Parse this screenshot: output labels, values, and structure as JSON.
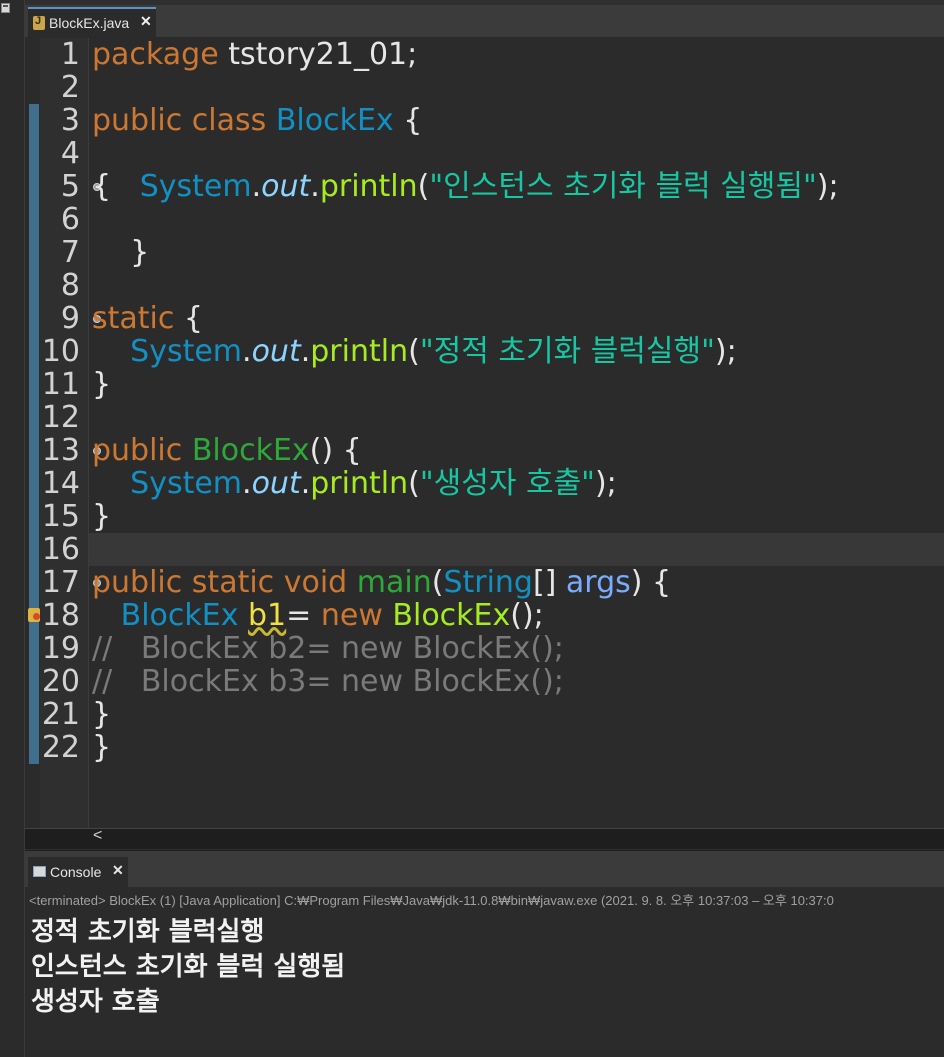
{
  "editor_tab": {
    "label": "BlockEx.java",
    "close": "✕"
  },
  "line_numbers": [
    "1",
    "2",
    "3",
    "4",
    "5",
    "6",
    "7",
    "8",
    "9",
    "10",
    "11",
    "12",
    "13",
    "14",
    "15",
    "16",
    "17",
    "18",
    "19",
    "20",
    "21",
    "22"
  ],
  "code": {
    "l1_kw": "package",
    "l1_rest": " tstory21_01;",
    "l3_kw": "public class",
    "l3_cls": "BlockEx",
    "l3_rest": " {",
    "l5_brace": "{   ",
    "l5_sys": "System",
    "l5_dot1": ".",
    "l5_out": "out",
    "l5_dot2": ".",
    "l5_meth": "println",
    "l5_p1": "(",
    "l5_str": "\"인스턴스 초기화 블럭 실행됨\"",
    "l5_p2": ");",
    "l7": "    }",
    "l9_kw": "static",
    "l9_rest": " {",
    "l10_ind": "    ",
    "l10_sys": "System",
    "l10_dot1": ".",
    "l10_out": "out",
    "l10_dot2": ".",
    "l10_meth": "println",
    "l10_p1": "(",
    "l10_str": "\"정적 초기화 블럭실행\"",
    "l10_p2": ");",
    "l11": "}",
    "l13_kw": "public",
    "l13_sp": " ",
    "l13_ctor": "BlockEx",
    "l13_rest": "() {",
    "l14_ind": "    ",
    "l14_sys": "System",
    "l14_dot1": ".",
    "l14_out": "out",
    "l14_dot2": ".",
    "l14_meth": "println",
    "l14_p1": "(",
    "l14_str": "\"생성자 호출\"",
    "l14_p2": ");",
    "l15": "}",
    "l17_kw": "public static void",
    "l17_sp": " ",
    "l17_main": "main",
    "l17_p": "(",
    "l17_str": "String",
    "l17_arr": "[] ",
    "l17_args": "args",
    "l17_rest": ") {",
    "l18_ind": "   ",
    "l18_cls": "BlockEx",
    "l18_sp": " ",
    "l18_var": "b1",
    "l18_eq": "= ",
    "l18_new": "new",
    "l18_sp2": " ",
    "l18_ctor": "BlockEx",
    "l18_rest": "();",
    "l19": "//   BlockEx b2= new BlockEx();",
    "l20": "//   BlockEx b3= new BlockEx();",
    "l21": "}",
    "l22": "}"
  },
  "hscroll_arrow": "<",
  "console_tab": {
    "label": "Console",
    "close": "✕"
  },
  "console_status": "<terminated> BlockEx (1) [Java Application] C:₩Program Files₩Java₩jdk-11.0.8₩bin₩javaw.exe  (2021. 9. 8. 오후 10:37:03 – 오후 10:37:0",
  "console_output": [
    "정적 초기화 블럭실행",
    "인스턴스 초기화 블럭 실행됨",
    "생성자 호출"
  ]
}
